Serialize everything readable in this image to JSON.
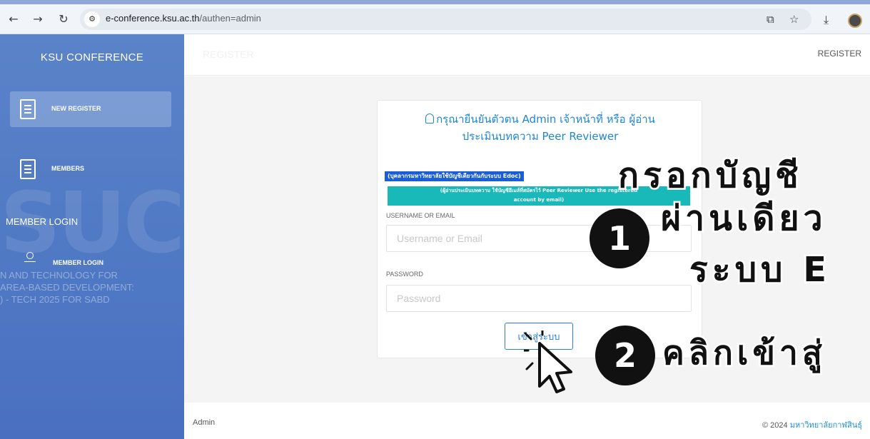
{
  "browser": {
    "url_domain": "e-conference.ksu.ac.th",
    "url_path": "/authen=admin"
  },
  "sidebar": {
    "brand": "KSU CONFERENCE",
    "items": [
      {
        "label": "NEW REGISTER",
        "active": true
      },
      {
        "label": "MEMBERS",
        "active": false
      }
    ],
    "member_login_text": "MEMBER LOGIN",
    "member_login_item": "MEMBER LOGIN",
    "watermark": "SUC",
    "faint_lines": [
      "N AND TECHNOLOGY FOR",
      "AREA-BASED DEVELOPMENT:",
      ") - TECH 2025 FOR SABD"
    ]
  },
  "header": {
    "left_faint": "REGISTER",
    "right": "REGISTER"
  },
  "card": {
    "title_line1": "กรุณายืนยันตัวตน Admin เจ้าหน้าที่ หรือ ผู้อ่าน",
    "title_line2": "ประเมินบทความ Peer Reviewer",
    "notice1": "(บุคลากรมหาวิทยาลัยใช้บัญชีเดียวกันกับระบบ Edoc)",
    "notice2_line1": "(ผู้อ่านประเมินบทความ ใช้บัญชีอีเมล์ที่สมัครไว้ Peer Reviewer Use the registered",
    "notice2_line2": "account by email)",
    "username_label": "USERNAME OR EMAIL",
    "username_placeholder": "Username or Email",
    "password_label": "PASSWORD",
    "password_placeholder": "Password",
    "submit_label": "เข้าสู่ระบบ"
  },
  "footer": {
    "left": "Admin",
    "copyright": "© 2024 ",
    "university": "มหาวิทยาลัยกาฬสินธุ์"
  },
  "overlay": {
    "step1_number": "1",
    "step1_line1": "กรอกบัญชี",
    "step1_line2": "ผ่านเดียว",
    "step1_line3": "ระบบ E",
    "step2_number": "2",
    "step2_text": "คลิกเข้าสู่"
  },
  "icons": {
    "back": "arrow-left-icon",
    "forward": "arrow-right-icon",
    "reload": "reload-icon",
    "site_info": "tune-icon",
    "translate": "translate-icon",
    "bookmark": "star-icon",
    "download": "download-icon",
    "profile": "avatar-icon"
  },
  "colors": {
    "sidebar": "#4f78c4",
    "title_blue": "#1f86d1",
    "notice_blue": "#1a5ed7",
    "notice_teal": "#19b9ba"
  }
}
